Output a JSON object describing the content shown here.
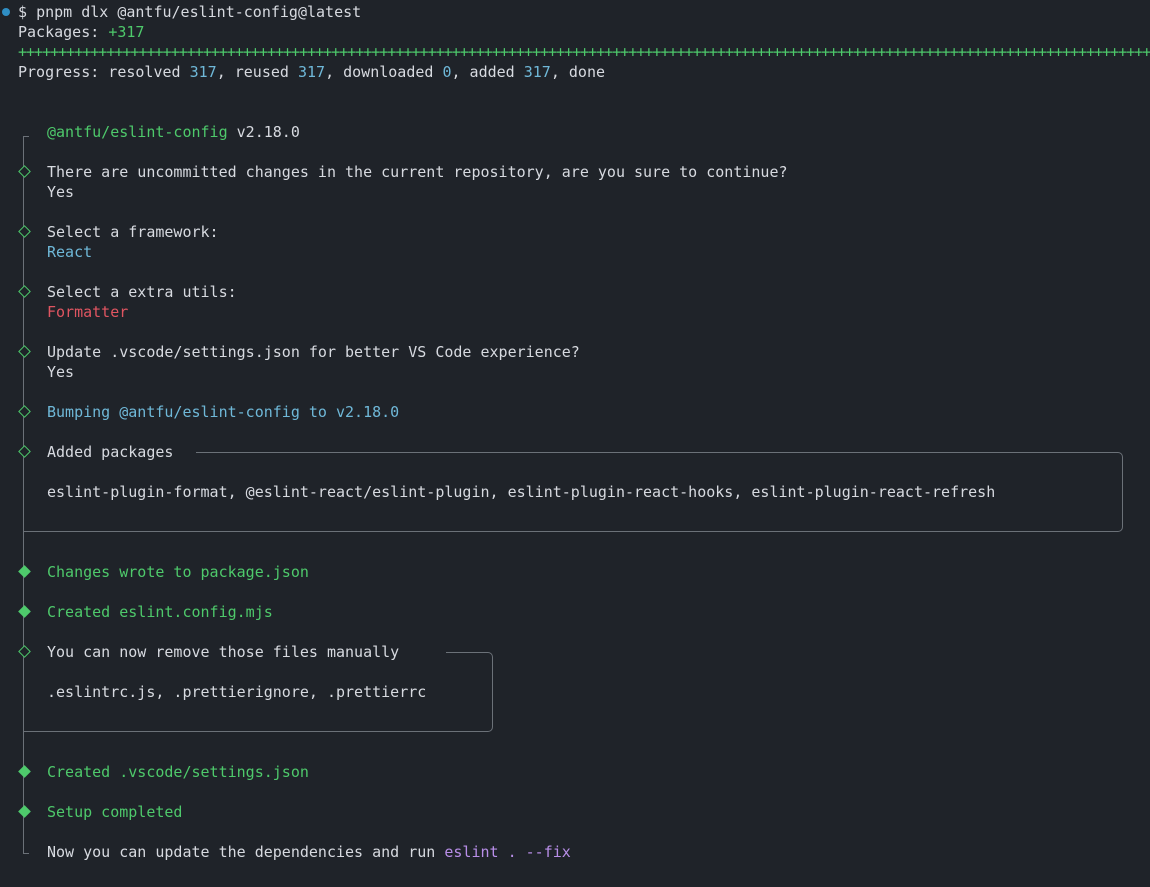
{
  "command": {
    "prompt": "$",
    "text": "pnpm dlx @antfu/eslint-config@latest"
  },
  "packages": {
    "label": "Packages:",
    "count": "+317",
    "bar": "++++++++++++++++++++++++++++++++++++++++++++++++++++++++++++++++++++++++++++++++++++++++++++++++++++++++++++++++++++++++++++++++++++++++++++++++++++++++++++++++++++++++++"
  },
  "progress": {
    "label": "Progress: resolved",
    "resolved": "317",
    "reused_label": ", reused",
    "reused": "317",
    "downloaded_label": ", downloaded",
    "downloaded": "0",
    "added_label": ", added",
    "added": "317",
    "done_label": ", done"
  },
  "header": {
    "package": "@antfu/eslint-config",
    "version": "v2.18.0"
  },
  "steps": {
    "uncommitted_question": "There are uncommitted changes in the current repository, are you sure to continue?",
    "uncommitted_answer": "Yes",
    "framework_question": "Select a framework:",
    "framework_answer": "React",
    "utils_question": "Select a extra utils:",
    "utils_answer": "Formatter",
    "vscode_question": "Update .vscode/settings.json for better VS Code experience?",
    "vscode_answer": "Yes",
    "bumping": "Bumping @antfu/eslint-config to v2.18.0",
    "added_packages_title": "Added packages",
    "added_packages_list": "eslint-plugin-format, @eslint-react/eslint-plugin, eslint-plugin-react-hooks, eslint-plugin-react-refresh",
    "changes_wrote": "Changes wrote to package.json",
    "created_config": "Created eslint.config.mjs",
    "remove_files_title": "You can now remove those files manually",
    "remove_files_list": ".eslintrc.js, .prettierignore, .prettierrc",
    "created_vscode": "Created .vscode/settings.json",
    "setup_completed": "Setup completed",
    "final_prefix": "Now you can update the dependencies and run",
    "final_command": "eslint . --fix"
  },
  "colors": {
    "background": "#1f2329",
    "accent_green": "#4ec96b",
    "accent_cyan": "#6fb8d8",
    "accent_red": "#e05561",
    "accent_purple": "#b88ee8"
  }
}
